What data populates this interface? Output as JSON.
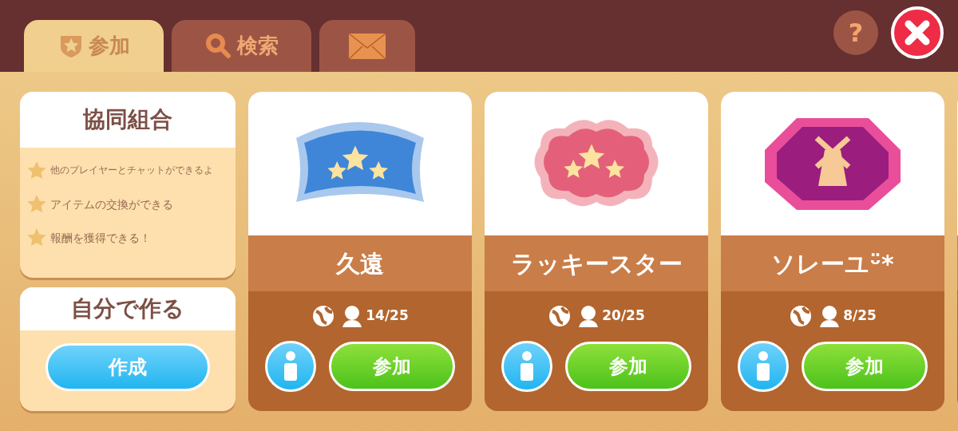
{
  "tabs": [
    {
      "label": "参加",
      "kind": "shield",
      "selected": true
    },
    {
      "label": "検索",
      "kind": "search",
      "selected": false
    },
    {
      "kind": "mail",
      "selected": false
    }
  ],
  "help_button": {
    "label": "?"
  },
  "info_panel": {
    "title": "協同組合",
    "features": [
      "他のプレイヤーとチャットができるよ",
      "アイテムの交換ができる",
      "報酬を獲得できる！"
    ]
  },
  "create_panel": {
    "title": "自分で作る",
    "button": "作成"
  },
  "guilds": [
    {
      "name": "久遠",
      "kind": "shield",
      "members": "14/25",
      "join": "参加"
    },
    {
      "name": "ラッキースター",
      "kind": "cloud",
      "members": "20/25",
      "join": "参加"
    },
    {
      "name": "ソレーユᵕ̈*",
      "kind": "octagon",
      "members": "8/25",
      "join": "参加"
    }
  ]
}
